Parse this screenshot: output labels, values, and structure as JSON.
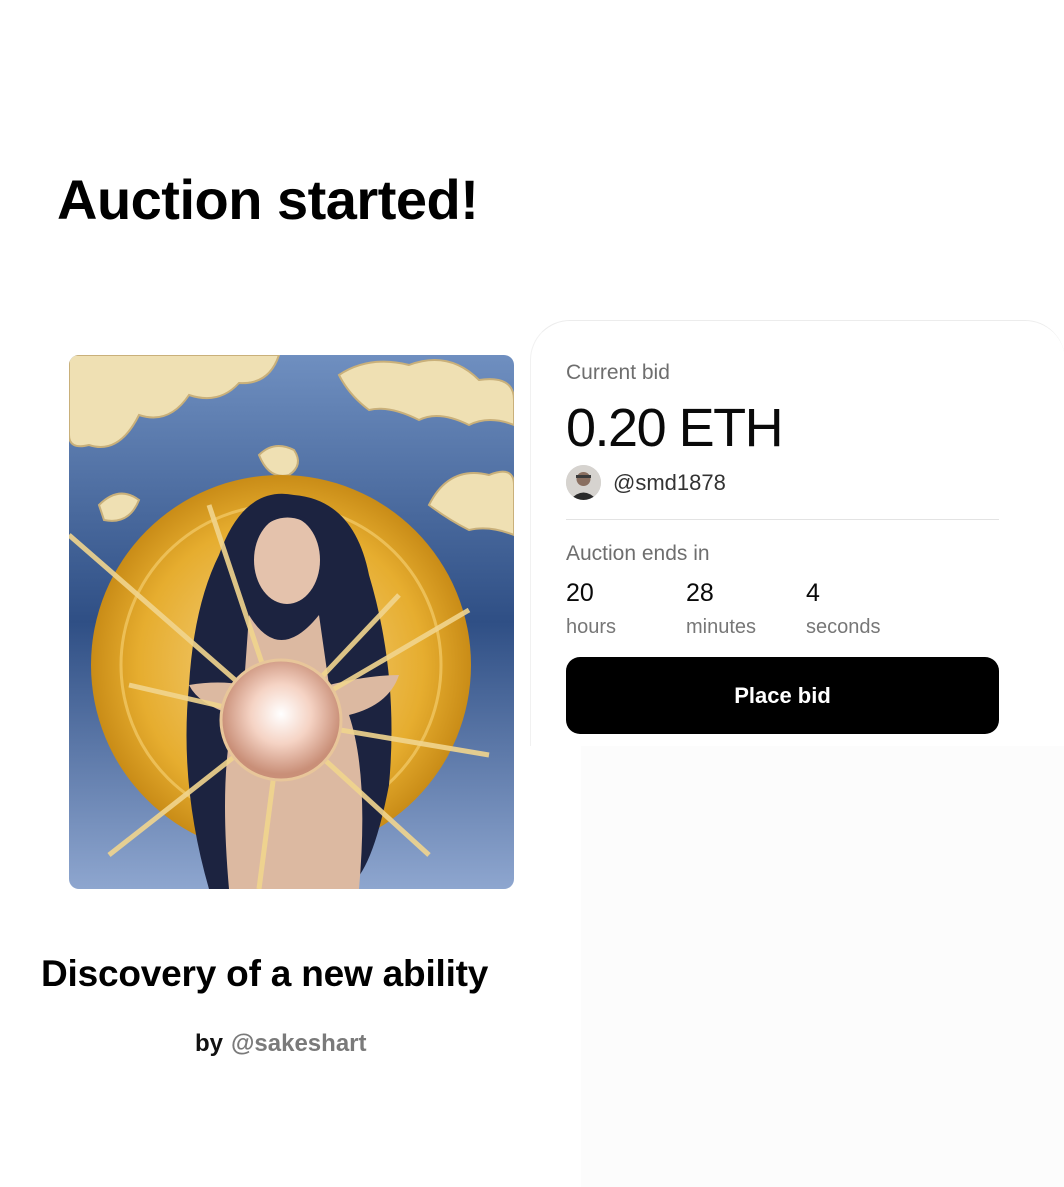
{
  "headline": "Auction started!",
  "auction": {
    "current_bid_label": "Current bid",
    "current_bid_value": "0.20 ETH",
    "bidder_handle": "@smd1878",
    "ends_label": "Auction ends in",
    "countdown": [
      {
        "value": "20",
        "unit": "hours"
      },
      {
        "value": "28",
        "unit": "minutes"
      },
      {
        "value": "4",
        "unit": "seconds"
      }
    ],
    "place_bid_label": "Place bid"
  },
  "artwork": {
    "title": "Discovery of a new ability",
    "by_label": "by",
    "artist_handle": "@sakeshart"
  },
  "colors": {
    "button_bg": "#000000",
    "button_text": "#ffffff",
    "muted_text": "#6e6e6e",
    "art_sky": "#2c4a7c",
    "art_halo": "#e9b53a"
  }
}
